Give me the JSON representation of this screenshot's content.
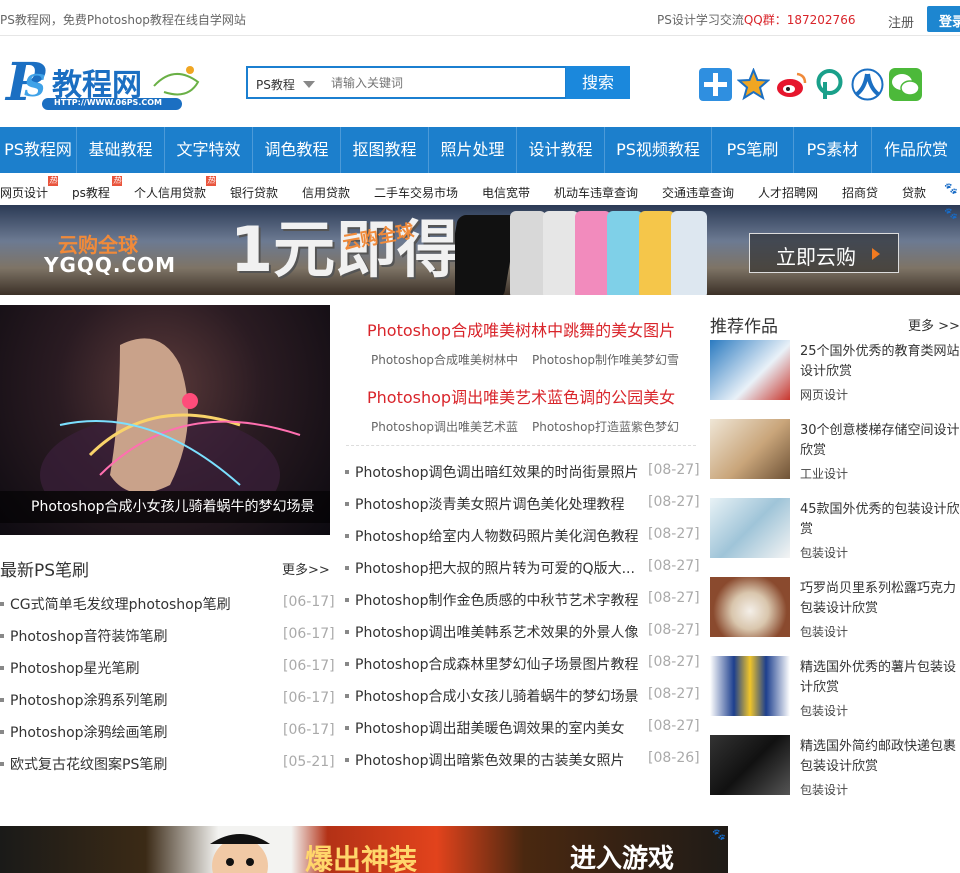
{
  "topbar": {
    "tagline": "PS教程网，免费Photoshop教程在线自学网站",
    "qq_prefix": "PS设计学习交流",
    "qq_label": "QQ群：187202766",
    "register": "注册",
    "login": "登录"
  },
  "logo": {
    "text": "教程网",
    "url_text": "HTTP://WWW.06PS.COM"
  },
  "search": {
    "category": "PS教程",
    "placeholder": "请输入关键词",
    "button": "搜索"
  },
  "social": [
    "plus-icon",
    "star-icon",
    "weibo-icon",
    "pinterest-icon",
    "renren-icon",
    "wechat-icon"
  ],
  "nav": [
    "PS教程网",
    "基础教程",
    "文字特效",
    "调色教程",
    "抠图教程",
    "照片处理",
    "设计教程",
    "PS视频教程",
    "PS笔刷",
    "PS素材",
    "作品欣赏"
  ],
  "subnav": [
    {
      "label": "网页设计",
      "hot": "热"
    },
    {
      "label": "ps教程",
      "hot": "热"
    },
    {
      "label": "个人信用贷款",
      "hot": "热"
    },
    {
      "label": "银行贷款",
      "hot": ""
    },
    {
      "label": "信用贷款",
      "hot": ""
    },
    {
      "label": "二手车交易市场",
      "hot": ""
    },
    {
      "label": "电信宽带",
      "hot": ""
    },
    {
      "label": "机动车违章查询",
      "hot": ""
    },
    {
      "label": "交通违章查询",
      "hot": ""
    },
    {
      "label": "人才招聘网",
      "hot": ""
    },
    {
      "label": "招商贷",
      "hot": ""
    },
    {
      "label": "贷款",
      "hot": ""
    }
  ],
  "banner": {
    "brand": "YGQQ.COM",
    "brand_cn": "云购全球",
    "headline": "1元即得",
    "tag": "云购全球",
    "cta": "立即云购"
  },
  "slider": {
    "caption": "Photoshop合成小女孩儿骑着蜗牛的梦幻场景",
    "dots": 5,
    "active": 1
  },
  "headlines": [
    {
      "title": "Photoshop合成唯美树林中跳舞的美女图片",
      "subs": [
        "Photoshop合成唯美树林中",
        "Photoshop制作唯美梦幻雪"
      ]
    },
    {
      "title": "Photoshop调出唯美艺术蓝色调的公园美女",
      "subs": [
        "Photoshop调出唯美艺术蓝",
        "Photoshop打造蓝紫色梦幻"
      ]
    }
  ],
  "middle_list": [
    {
      "title": "Photoshop调色调出暗红效果的时尚街景照片",
      "date": "[08-27]"
    },
    {
      "title": "Photoshop淡青美女照片调色美化处理教程",
      "date": "[08-27]"
    },
    {
      "title": "Photoshop给室内人物数码照片美化润色教程",
      "date": "[08-27]"
    },
    {
      "title": "Photoshop把大叔的照片转为可爱的Q版大...",
      "date": "[08-27]"
    },
    {
      "title": "Photoshop制作金色质感的中秋节艺术字教程",
      "date": "[08-27]"
    },
    {
      "title": "Photoshop调出唯美韩系艺术效果的外景人像",
      "date": "[08-27]"
    },
    {
      "title": "Photoshop合成森林里梦幻仙子场景图片教程",
      "date": "[08-27]"
    },
    {
      "title": "Photoshop合成小女孩儿骑着蜗牛的梦幻场景",
      "date": "[08-27]"
    },
    {
      "title": "Photoshop调出甜美暖色调效果的室内美女",
      "date": "[08-27]"
    },
    {
      "title": "Photoshop调出暗紫色效果的古装美女照片",
      "date": "[08-26]"
    }
  ],
  "brushes": {
    "heading": "最新PS笔刷",
    "more": "更多>>",
    "items": [
      {
        "title": "CG式简单毛发纹理photoshop笔刷",
        "date": "[06-17]"
      },
      {
        "title": "Photoshop音符装饰笔刷",
        "date": "[06-17]"
      },
      {
        "title": "Photoshop星光笔刷",
        "date": "[06-17]"
      },
      {
        "title": "Photoshop涂鸦系列笔刷",
        "date": "[06-17]"
      },
      {
        "title": "Photoshop涂鸦绘画笔刷",
        "date": "[06-17]"
      },
      {
        "title": "欧式复古花纹图案PS笔刷",
        "date": "[05-21]"
      }
    ]
  },
  "recommend": {
    "heading": "推荐作品",
    "more": "更多 >>",
    "items": [
      {
        "title": "25个国外优秀的教育类网站设计欣赏",
        "category": "网页设计",
        "color": "#2a7ac0"
      },
      {
        "title": "30个创意楼梯存储空间设计欣赏",
        "category": "工业设计",
        "color": "#c9a57a"
      },
      {
        "title": "45款国外优秀的包装设计欣赏",
        "category": "包装设计",
        "color": "#9fc4d8"
      },
      {
        "title": "巧罗尚贝里系列松露巧克力包装设计欣赏",
        "category": "包装设计",
        "color": "#8a4a2e"
      },
      {
        "title": "精选国外优秀的薯片包装设计欣赏",
        "category": "包装设计",
        "color": "#1d3f8e"
      },
      {
        "title": "精选国外简约邮政快递包裹包装设计欣赏",
        "category": "包装设计",
        "color": "#222222"
      }
    ]
  },
  "ad2": {
    "boom": "爆出神装",
    "enter": "进入游戏"
  },
  "colors": {
    "nav": "#1c7fcc",
    "accent_red": "#d9252b",
    "orange": "#f47c20"
  }
}
